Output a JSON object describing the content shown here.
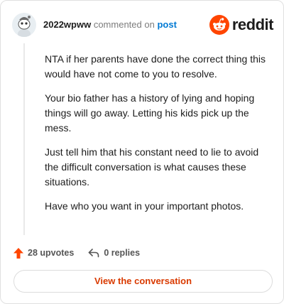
{
  "header": {
    "username": "2022wpww",
    "action_text": "commented on",
    "post_link": "post",
    "logo_word": "reddit"
  },
  "comment": {
    "paragraphs": [
      "NTA if her parents have done the correct thing this would have not come to you to resolve.",
      "Your bio father has a history of lying and hoping things will go away. Letting his kids pick up the mess.",
      "Just tell him that his constant need to lie to avoid the difficult conversation is what causes these situations.",
      "Have who you want in your important photos."
    ]
  },
  "actions": {
    "upvotes": "28 upvotes",
    "replies": "0 replies"
  },
  "cta": {
    "label": "View the conversation"
  },
  "colors": {
    "accent": "#d93a00",
    "upvote": "#ff4500",
    "link": "#0079d3"
  },
  "icons": {
    "upvote": "upvote-arrow-icon",
    "reply": "reply-arrow-icon",
    "logo": "reddit-snoo-icon"
  }
}
